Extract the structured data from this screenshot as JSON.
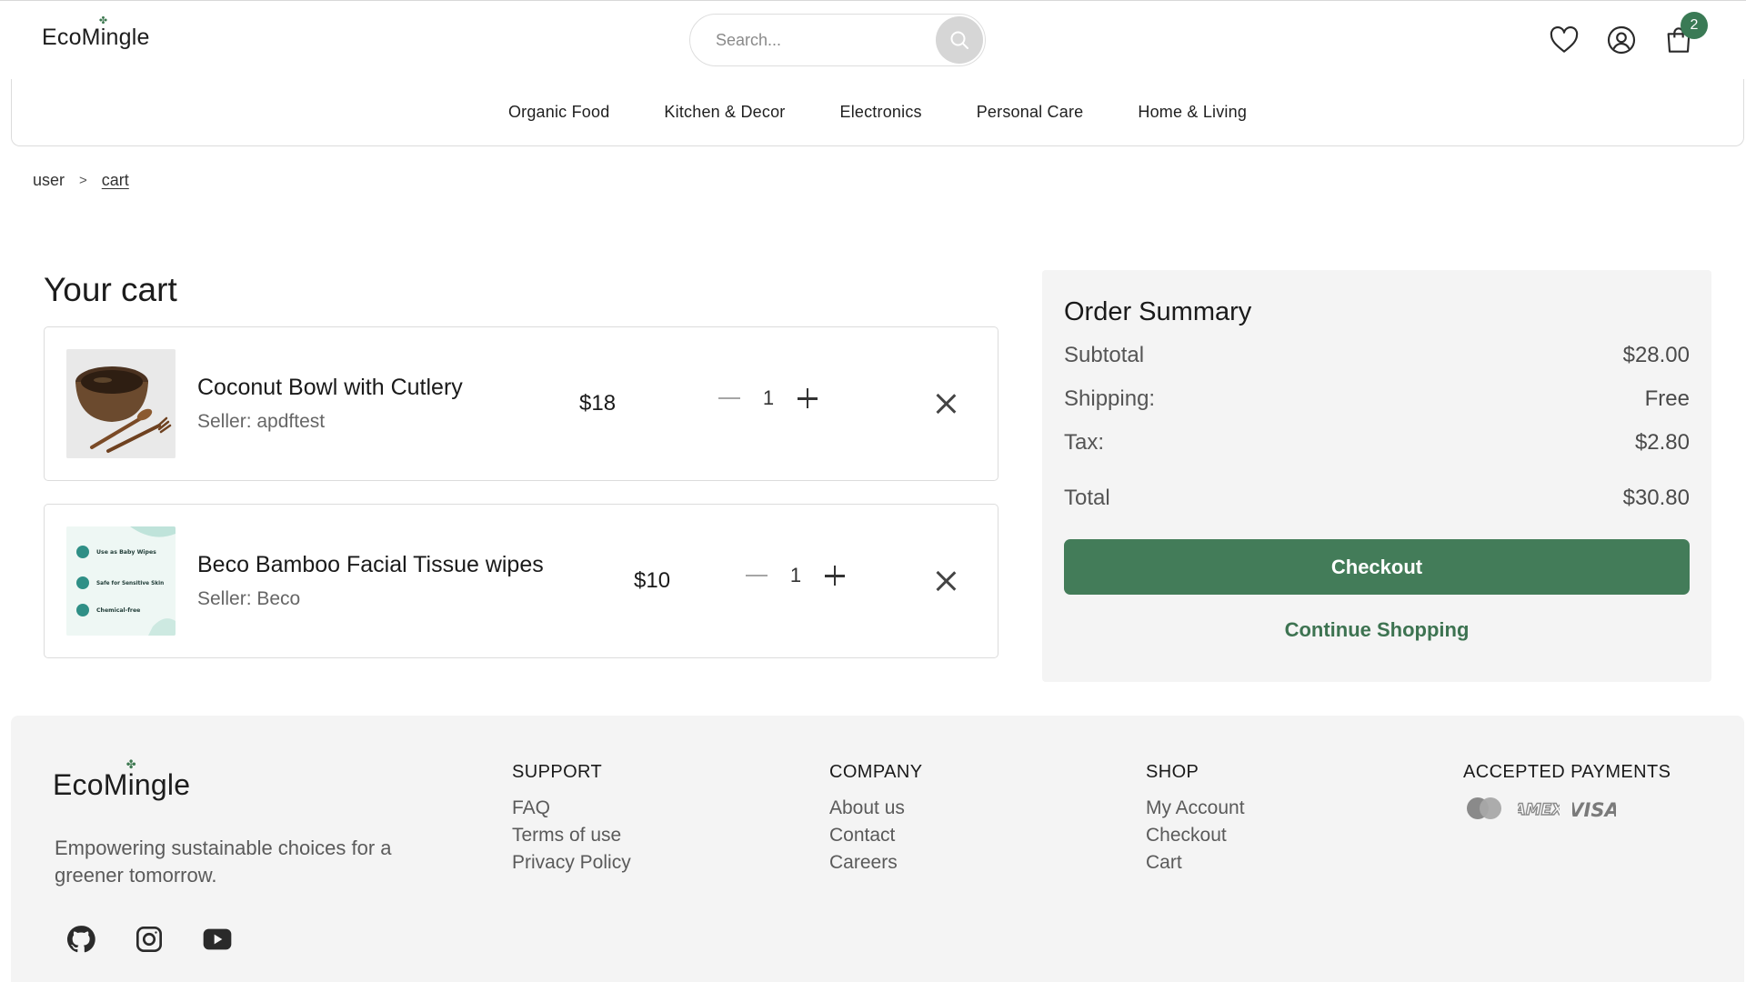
{
  "brand": {
    "name_part1": "EcoM",
    "name_i": "i",
    "name_part2": "ngle"
  },
  "header": {
    "search_placeholder": "Search...",
    "cart_count": "2",
    "icons": [
      "search-icon",
      "heart-icon",
      "user-icon",
      "cart-icon"
    ]
  },
  "categories": [
    "Organic Food",
    "Kitchen & Decor",
    "Electronics",
    "Personal Care",
    "Home & Living"
  ],
  "breadcrumb": {
    "parent": "user",
    "separator": ">",
    "current": "cart"
  },
  "cart": {
    "title": "Your cart",
    "items": [
      {
        "name": "Coconut Bowl with Cutlery",
        "seller": "Seller: apdftest",
        "price": "$18",
        "quantity": "1"
      },
      {
        "name": "Beco Bamboo Facial Tissue wipes",
        "seller": "Seller: Beco",
        "price": "$10",
        "quantity": "1",
        "image_text": [
          "Use as Baby Wipes",
          "Safe for Sensitive Skin",
          "Chemical-free"
        ]
      }
    ]
  },
  "summary": {
    "title": "Order Summary",
    "subtotal_label": "Subtotal",
    "subtotal_value": "$28.00",
    "shipping_label": "Shipping:",
    "shipping_value": "Free",
    "tax_label": "Tax:",
    "tax_value": "$2.80",
    "total_label": "Total",
    "total_value": "$30.80",
    "checkout_label": "Checkout",
    "continue_label": "Continue Shopping"
  },
  "footer": {
    "tagline": "Empowering sustainable choices for a greener tomorrow.",
    "social_icons": [
      "github-icon",
      "instagram-icon",
      "youtube-icon"
    ],
    "support": {
      "heading": "SUPPORT",
      "links": [
        "FAQ",
        "Terms of use",
        "Privacy Policy"
      ]
    },
    "company": {
      "heading": "COMPANY",
      "links": [
        "About us",
        "Contact",
        "Careers"
      ]
    },
    "shop": {
      "heading": "SHOP",
      "links": [
        "My Account",
        "Checkout",
        "Cart"
      ]
    },
    "payments": {
      "heading": "ACCEPTED PAYMENTS",
      "amex": "AMEX",
      "visa": "VISA"
    }
  },
  "colors": {
    "accent": "#437c59",
    "badge": "#3a7a55",
    "summary_bg": "#f4f4f4",
    "footer_bg": "#f4f4f4"
  }
}
